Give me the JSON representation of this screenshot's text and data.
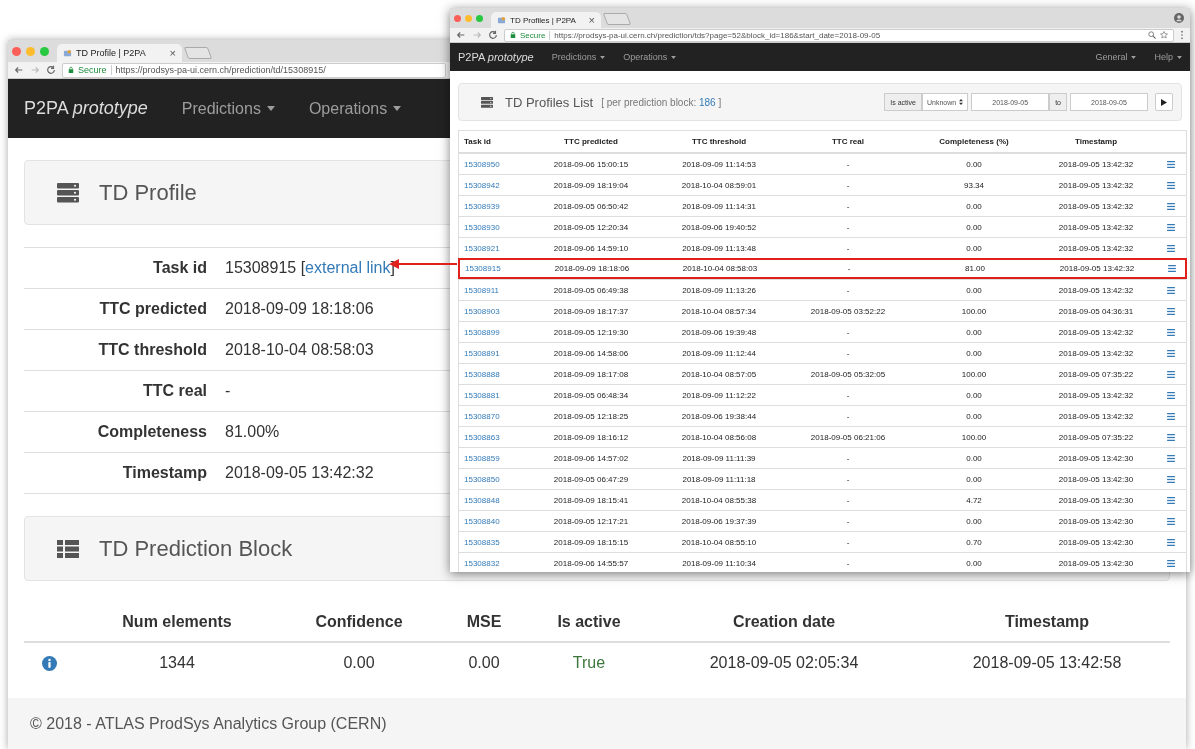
{
  "back_window": {
    "tab_title": "TD Profile | P2PA",
    "tab_close": "×",
    "secure_label": "Secure",
    "url": "https://prodsys-pa-ui.cern.ch/prediction/td/15308915/",
    "navbar": {
      "brand": "P2PA *prototype*",
      "menus": [
        "Predictions",
        "Operations"
      ]
    },
    "profile_panel": {
      "title": "TD Profile"
    },
    "fields": [
      {
        "label": "Task id",
        "value": "15308915 [",
        "link": "external link",
        "after": "]"
      },
      {
        "label": "TTC predicted",
        "value": "2018-09-09 18:18:06"
      },
      {
        "label": "TTC threshold",
        "value": "2018-10-04 08:58:03"
      },
      {
        "label": "TTC real",
        "value": "-"
      },
      {
        "label": "Completeness",
        "value": "81.00%"
      },
      {
        "label": "Timestamp",
        "value": "2018-09-05 13:42:32"
      }
    ],
    "block_panel": {
      "title": "TD Prediction Block"
    },
    "block_table": {
      "columns": [
        "Num elements",
        "Confidence",
        "MSE",
        "Is active",
        "Creation date",
        "Timestamp"
      ],
      "rows": [
        {
          "cells": [
            "1344",
            "0.00",
            "0.00",
            "True",
            "2018-09-05 02:05:34",
            "2018-09-05 13:42:58"
          ],
          "active": true
        }
      ]
    },
    "footer": "© 2018 - ATLAS ProdSys Analytics Group (CERN)"
  },
  "front_window": {
    "tab_title": "TD Profiles | P2PA",
    "tab_close": "×",
    "secure_label": "Secure",
    "url": "https://prodsys-pa-ui.cern.ch/prediction/tds?page=52&block_id=186&start_date=2018-09-05",
    "navbar": {
      "brand": "P2PA *prototype*",
      "menus": [
        "Predictions",
        "Operations"
      ],
      "right_menus": [
        "General",
        "Help"
      ]
    },
    "list_panel": {
      "title": "TD Profiles List",
      "note_open": "[ per prediction block:",
      "count": "186",
      "note_close": "]",
      "filter": {
        "label": "Is active",
        "select": "Unknown",
        "date_from": "2018-09-05",
        "to": "to",
        "date_to": "2018-09-05"
      }
    },
    "table": {
      "columns": [
        "Task id",
        "TTC predicted",
        "TTC threshold",
        "TTC real",
        "Completeness (%)",
        "Timestamp"
      ],
      "rows": [
        {
          "cells": [
            "15308950",
            "2018-09-06 15:00:15",
            "2018-09-09 11:14:53",
            "-",
            "0.00",
            "2018-09-05 13:42:32"
          ],
          "highlighted": false
        },
        {
          "cells": [
            "15308942",
            "2018-09-09 18:19:04",
            "2018-10-04 08:59:01",
            "-",
            "93.34",
            "2018-09-05 13:42:32"
          ],
          "highlighted": false
        },
        {
          "cells": [
            "15308939",
            "2018-09-05 06:50:42",
            "2018-09-09 11:14:31",
            "-",
            "0.00",
            "2018-09-05 13:42:32"
          ],
          "highlighted": false
        },
        {
          "cells": [
            "15308930",
            "2018-09-05 12:20:34",
            "2018-09-06 19:40:52",
            "-",
            "0.00",
            "2018-09-05 13:42:32"
          ],
          "highlighted": false
        },
        {
          "cells": [
            "15308921",
            "2018-09-06 14:59:10",
            "2018-09-09 11:13:48",
            "-",
            "0.00",
            "2018-09-05 13:42:32"
          ],
          "highlighted": false
        },
        {
          "cells": [
            "15308915",
            "2018-09-09 18:18:06",
            "2018-10-04 08:58:03",
            "-",
            "81.00",
            "2018-09-05 13:42:32"
          ],
          "highlighted": true
        },
        {
          "cells": [
            "15308911",
            "2018-09-05 06:49:38",
            "2018-09-09 11:13:26",
            "-",
            "0.00",
            "2018-09-05 13:42:32"
          ],
          "highlighted": false
        },
        {
          "cells": [
            "15308903",
            "2018-09-09 18:17:37",
            "2018-10-04 08:57:34",
            "2018-09-05 03:52:22",
            "100.00",
            "2018-09-05 04:36:31"
          ],
          "highlighted": false
        },
        {
          "cells": [
            "15308899",
            "2018-09-05 12:19:30",
            "2018-09-06 19:39:48",
            "-",
            "0.00",
            "2018-09-05 13:42:32"
          ],
          "highlighted": false
        },
        {
          "cells": [
            "15308891",
            "2018-09-06 14:58:06",
            "2018-09-09 11:12:44",
            "-",
            "0.00",
            "2018-09-05 13:42:32"
          ],
          "highlighted": false
        },
        {
          "cells": [
            "15308888",
            "2018-09-09 18:17:08",
            "2018-10-04 08:57:05",
            "2018-09-05 05:32:05",
            "100.00",
            "2018-09-05 07:35:22"
          ],
          "highlighted": false
        },
        {
          "cells": [
            "15308881",
            "2018-09-05 06:48:34",
            "2018-09-09 11:12:22",
            "-",
            "0.00",
            "2018-09-05 13:42:32"
          ],
          "highlighted": false
        },
        {
          "cells": [
            "15308870",
            "2018-09-05 12:18:25",
            "2018-09-06 19:38:44",
            "-",
            "0.00",
            "2018-09-05 13:42:32"
          ],
          "highlighted": false
        },
        {
          "cells": [
            "15308863",
            "2018-09-09 18:16:12",
            "2018-10-04 08:56:08",
            "2018-09-05 06:21:06",
            "100.00",
            "2018-09-05 07:35:22"
          ],
          "highlighted": false
        },
        {
          "cells": [
            "15308859",
            "2018-09-06 14:57:02",
            "2018-09-09 11:11:39",
            "-",
            "0.00",
            "2018-09-05 13:42:30"
          ],
          "highlighted": false
        },
        {
          "cells": [
            "15308850",
            "2018-09-05 06:47:29",
            "2018-09-09 11:11:18",
            "-",
            "0.00",
            "2018-09-05 13:42:30"
          ],
          "highlighted": false
        },
        {
          "cells": [
            "15308848",
            "2018-09-09 18:15:41",
            "2018-10-04 08:55:38",
            "-",
            "4.72",
            "2018-09-05 13:42:30"
          ],
          "highlighted": false
        },
        {
          "cells": [
            "15308840",
            "2018-09-05 12:17:21",
            "2018-09-06 19:37:39",
            "-",
            "0.00",
            "2018-09-05 13:42:30"
          ],
          "highlighted": false
        },
        {
          "cells": [
            "15308835",
            "2018-09-09 18:15:15",
            "2018-10-04 08:55:10",
            "-",
            "0.70",
            "2018-09-05 13:42:30"
          ],
          "highlighted": false
        },
        {
          "cells": [
            "15308832",
            "2018-09-06 14:55:57",
            "2018-09-09 11:10:34",
            "-",
            "0.00",
            "2018-09-05 13:42:30"
          ],
          "highlighted": false
        }
      ]
    }
  }
}
